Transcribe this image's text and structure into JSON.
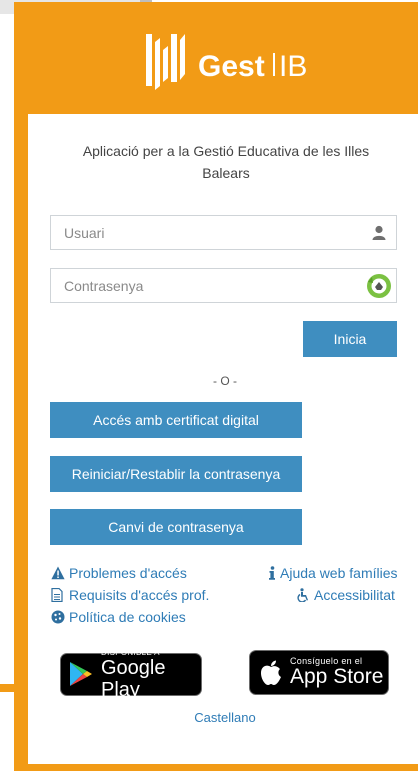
{
  "brand": {
    "name_bold": "Gest",
    "name_light": "IB"
  },
  "subtitle": "Aplicació per a la Gestió Educativa de les Illes Balears",
  "login": {
    "user_placeholder": "Usuari",
    "password_placeholder": "Contrasenya",
    "submit_label": "Inicia"
  },
  "separator": "- O -",
  "actions": {
    "certificate": "Accés amb certificat digital",
    "reset_password": "Reiniciar/Restablir la contrasenya",
    "change_password": "Canvi de contrasenya"
  },
  "links": {
    "problems": "Problemes d'accés",
    "requirements": "Requisits d'accés prof.",
    "cookies": "Política de cookies",
    "help_families": "Ajuda web famílies",
    "accessibility": "Accessibilitat"
  },
  "stores": {
    "google_small": "DISPONIBLE A",
    "google_big": "Google Play",
    "apple_small": "Consíguelo en el",
    "apple_big": "App Store"
  },
  "language_link": "Castellano",
  "colors": {
    "brand_orange": "#f29b16",
    "button_blue": "#3f8ec0",
    "link_blue": "#2f7cb6"
  },
  "icons": {
    "user_field": "user-icon",
    "password_field": "password-manager-icon",
    "problems": "warning-icon",
    "requirements": "document-icon",
    "cookies": "cookie-icon",
    "help": "info-icon",
    "accessibility": "accessibility-icon"
  }
}
